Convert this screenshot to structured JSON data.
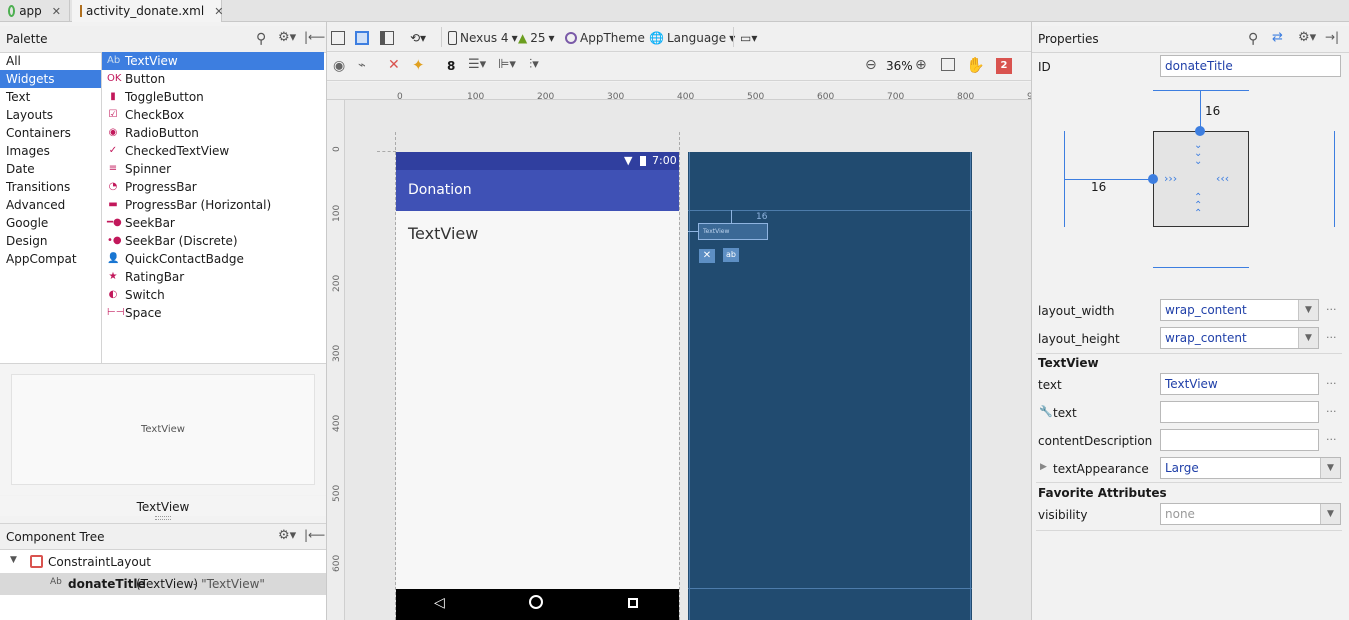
{
  "tabs": [
    {
      "label": "app",
      "active": false
    },
    {
      "label": "activity_donate.xml",
      "active": true
    }
  ],
  "palette": {
    "title": "Palette",
    "categories": [
      "All",
      "Widgets",
      "Text",
      "Layouts",
      "Containers",
      "Images",
      "Date",
      "Transitions",
      "Advanced",
      "Google",
      "Design",
      "AppCompat"
    ],
    "selected_category": "Widgets",
    "widgets": [
      {
        "label": "TextView",
        "icon": "textview-icon"
      },
      {
        "label": "Button",
        "icon": "button-icon"
      },
      {
        "label": "ToggleButton",
        "icon": "togglebutton-icon"
      },
      {
        "label": "CheckBox",
        "icon": "checkbox-icon"
      },
      {
        "label": "RadioButton",
        "icon": "radiobutton-icon"
      },
      {
        "label": "CheckedTextView",
        "icon": "checkedtextview-icon"
      },
      {
        "label": "Spinner",
        "icon": "spinner-icon"
      },
      {
        "label": "ProgressBar",
        "icon": "progressbar-icon"
      },
      {
        "label": "ProgressBar (Horizontal)",
        "icon": "progressbar-horizontal-icon"
      },
      {
        "label": "SeekBar",
        "icon": "seekbar-icon"
      },
      {
        "label": "SeekBar (Discrete)",
        "icon": "seekbar-discrete-icon"
      },
      {
        "label": "QuickContactBadge",
        "icon": "quickcontactbadge-icon"
      },
      {
        "label": "RatingBar",
        "icon": "ratingbar-icon"
      },
      {
        "label": "Switch",
        "icon": "switch-icon"
      },
      {
        "label": "Space",
        "icon": "space-icon"
      }
    ],
    "preview_text": "TextView",
    "preview_caption": "TextView"
  },
  "component_tree": {
    "title": "Component Tree",
    "root": "ConstraintLayout",
    "child_id": "donateTitle",
    "child_type": "(TextView)",
    "child_text": "- \"TextView\""
  },
  "toolbar": {
    "device": "Nexus 4",
    "api": "25",
    "theme": "AppTheme",
    "language": "Language",
    "default_margin": "8",
    "zoom": "36%",
    "issues_count": "2"
  },
  "ruler": {
    "top": [
      "0",
      "100",
      "200",
      "300",
      "400",
      "500",
      "600",
      "700",
      "800",
      "9"
    ],
    "left": [
      "0",
      "100",
      "200",
      "300",
      "400",
      "500",
      "600"
    ]
  },
  "device_preview": {
    "status_time": "7:00",
    "app_title": "Donation",
    "textview": "TextView"
  },
  "blueprint": {
    "widget_text": "TextView",
    "margin_label": "16"
  },
  "properties": {
    "title": "Properties",
    "id_label": "ID",
    "id_value": "donateTitle",
    "margin_top": "16",
    "margin_left": "16",
    "layout_width_label": "layout_width",
    "layout_width_value": "wrap_content",
    "layout_height_label": "layout_height",
    "layout_height_value": "wrap_content",
    "section_textview": "TextView",
    "text_label": "text",
    "text_value": "TextView",
    "tools_text_label": "text",
    "tools_text_value": "",
    "content_desc_label": "contentDescription",
    "content_desc_value": "",
    "text_appearance_label": "textAppearance",
    "text_appearance_value": "Large",
    "section_favorites": "Favorite Attributes",
    "visibility_label": "visibility",
    "visibility_value": "none"
  },
  "colors": {
    "accent": "#3d7ee0",
    "app_bar": "#3f51b5",
    "status_bar": "#303f9f",
    "blueprint": "#214b70"
  }
}
